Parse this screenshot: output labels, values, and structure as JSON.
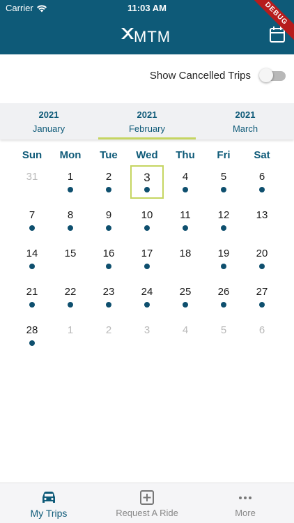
{
  "status": {
    "carrier": "Carrier",
    "time": "11:03 AM"
  },
  "header": {
    "logo": "MTM",
    "debug_ribbon": "DEBUG"
  },
  "toggle": {
    "label": "Show Cancelled Trips",
    "on": false
  },
  "months": [
    {
      "year": "2021",
      "name": "January"
    },
    {
      "year": "2021",
      "name": "February",
      "selected": true
    },
    {
      "year": "2021",
      "name": "March"
    }
  ],
  "weekdays": [
    "Sun",
    "Mon",
    "Tue",
    "Wed",
    "Thu",
    "Fri",
    "Sat"
  ],
  "weeks": [
    [
      {
        "d": "31",
        "muted": true
      },
      {
        "d": "1",
        "dot": true
      },
      {
        "d": "2",
        "dot": true
      },
      {
        "d": "3",
        "dot": true,
        "selected": true
      },
      {
        "d": "4",
        "dot": true
      },
      {
        "d": "5",
        "dot": true
      },
      {
        "d": "6",
        "dot": true
      }
    ],
    [
      {
        "d": "7",
        "dot": true
      },
      {
        "d": "8",
        "dot": true
      },
      {
        "d": "9",
        "dot": true
      },
      {
        "d": "10",
        "dot": true
      },
      {
        "d": "11",
        "dot": true
      },
      {
        "d": "12",
        "dot": true
      },
      {
        "d": "13"
      }
    ],
    [
      {
        "d": "14",
        "dot": true
      },
      {
        "d": "15"
      },
      {
        "d": "16",
        "dot": true
      },
      {
        "d": "17",
        "dot": true
      },
      {
        "d": "18"
      },
      {
        "d": "19",
        "dot": true
      },
      {
        "d": "20",
        "dot": true
      }
    ],
    [
      {
        "d": "21",
        "dot": true
      },
      {
        "d": "22",
        "dot": true
      },
      {
        "d": "23",
        "dot": true
      },
      {
        "d": "24",
        "dot": true
      },
      {
        "d": "25",
        "dot": true
      },
      {
        "d": "26",
        "dot": true
      },
      {
        "d": "27",
        "dot": true
      }
    ],
    [
      {
        "d": "28",
        "dot": true
      },
      {
        "d": "1",
        "muted": true
      },
      {
        "d": "2",
        "muted": true
      },
      {
        "d": "3",
        "muted": true
      },
      {
        "d": "4",
        "muted": true
      },
      {
        "d": "5",
        "muted": true
      },
      {
        "d": "6",
        "muted": true
      }
    ]
  ],
  "tabs": {
    "my_trips": "My Trips",
    "request_ride": "Request A Ride",
    "more": "More"
  },
  "colors": {
    "primary": "#0e5a78",
    "accent": "#c5d561",
    "dot": "#0e4f6e"
  }
}
